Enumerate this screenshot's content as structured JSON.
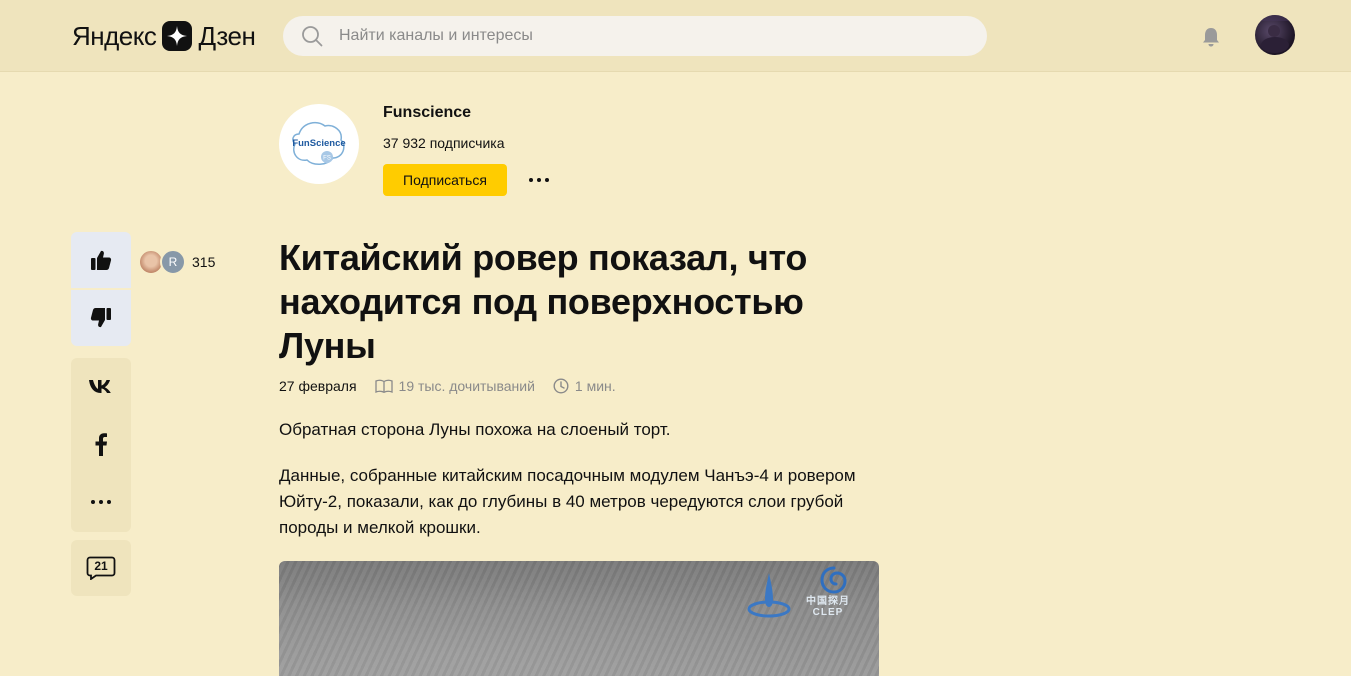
{
  "header": {
    "logo_left": "Яндекс",
    "logo_right": "Дзен",
    "search_placeholder": "Найти каналы и интересы"
  },
  "channel": {
    "name": "Funscience",
    "logo_text": "FunScience",
    "logo_badge": "FS",
    "subscribers": "37 932 подписчика",
    "subscribe_label": "Подписаться"
  },
  "actions": {
    "like_count": "315",
    "liker_initial": "R",
    "comments_count": "21"
  },
  "article": {
    "title": "Китайский ровер показал, что находится под поверхностью Луны",
    "date": "27 февраля",
    "reads": "19 тыс. дочитываний",
    "read_time": "1 мин.",
    "paragraphs": [
      "Обратная сторона Луны похожа на слоеный торт.",
      "Данные, собранные китайским посадочным модулем Чанъэ-4 и ровером Юйту-2, показали, как до глубины в 40 метров чередуются слои грубой породы и мелкой крошки."
    ],
    "image_caption_cn": "中国探月",
    "image_caption_en": "CLEP"
  },
  "colors": {
    "background": "#f7edc9",
    "header": "#efe4bd",
    "subscribe": "#ffcc00",
    "like_panel": "#e6eaf2"
  }
}
